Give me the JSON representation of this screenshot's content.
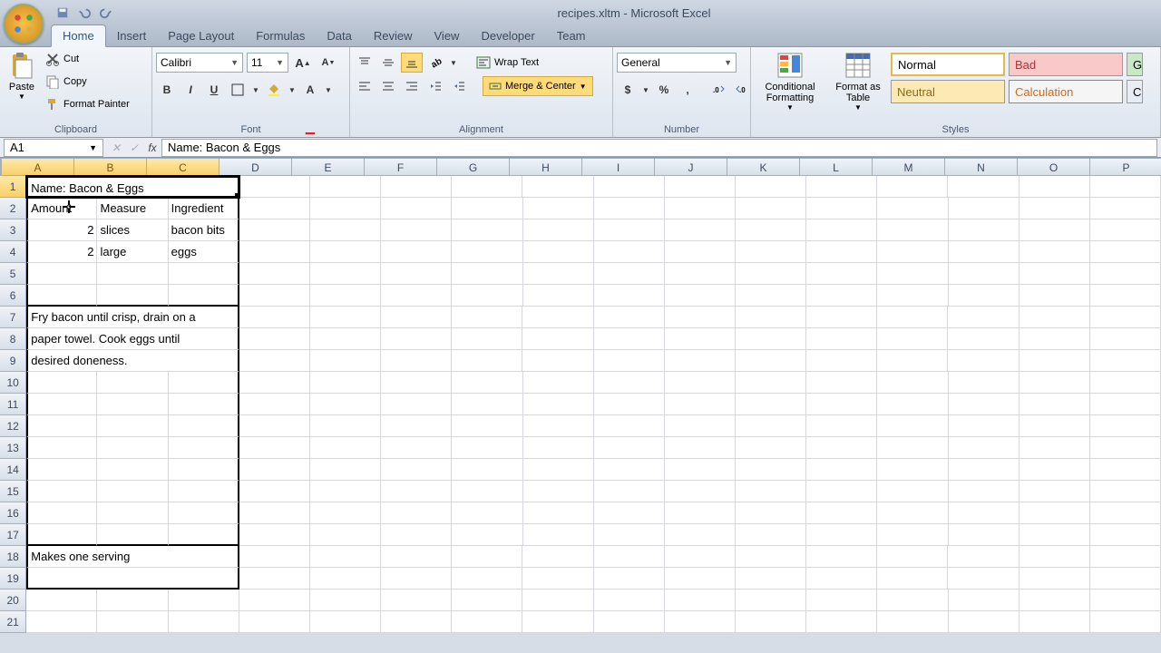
{
  "title": "recipes.xltm - Microsoft Excel",
  "tabs": [
    "Home",
    "Insert",
    "Page Layout",
    "Formulas",
    "Data",
    "Review",
    "View",
    "Developer",
    "Team"
  ],
  "active_tab": "Home",
  "clipboard": {
    "paste": "Paste",
    "cut": "Cut",
    "copy": "Copy",
    "painter": "Format Painter",
    "label": "Clipboard"
  },
  "font": {
    "name": "Calibri",
    "size": "11",
    "label": "Font"
  },
  "alignment": {
    "wrap": "Wrap Text",
    "merge": "Merge & Center",
    "label": "Alignment"
  },
  "number": {
    "format": "General",
    "label": "Number"
  },
  "styles": {
    "conditional": "Conditional Formatting",
    "formatas": "Format as Table",
    "normal": "Normal",
    "bad": "Bad",
    "good": "G",
    "neutral": "Neutral",
    "calculation": "Calculation",
    "check": "C",
    "label": "Styles"
  },
  "namebox": "A1",
  "formula": "Name: Bacon & Eggs",
  "columns": [
    "A",
    "B",
    "C",
    "D",
    "E",
    "F",
    "G",
    "H",
    "I",
    "J",
    "K",
    "L",
    "M",
    "N",
    "O",
    "P"
  ],
  "selected_cols": [
    "A",
    "B",
    "C"
  ],
  "selected_row": 1,
  "cells": {
    "A1": "Name: Bacon & Eggs",
    "A2": "Amount",
    "B2": "Measure",
    "C2": "Ingredient",
    "A3": "2",
    "B3": "slices",
    "C3": "bacon bits",
    "A4": "2",
    "B4": "large",
    "C4": "eggs",
    "A7": "Fry bacon until crisp, drain on a",
    "A8": "paper towel.  Cook eggs until",
    "A9": "desired doneness.",
    "A18": "Makes one serving"
  },
  "row_count": 21
}
